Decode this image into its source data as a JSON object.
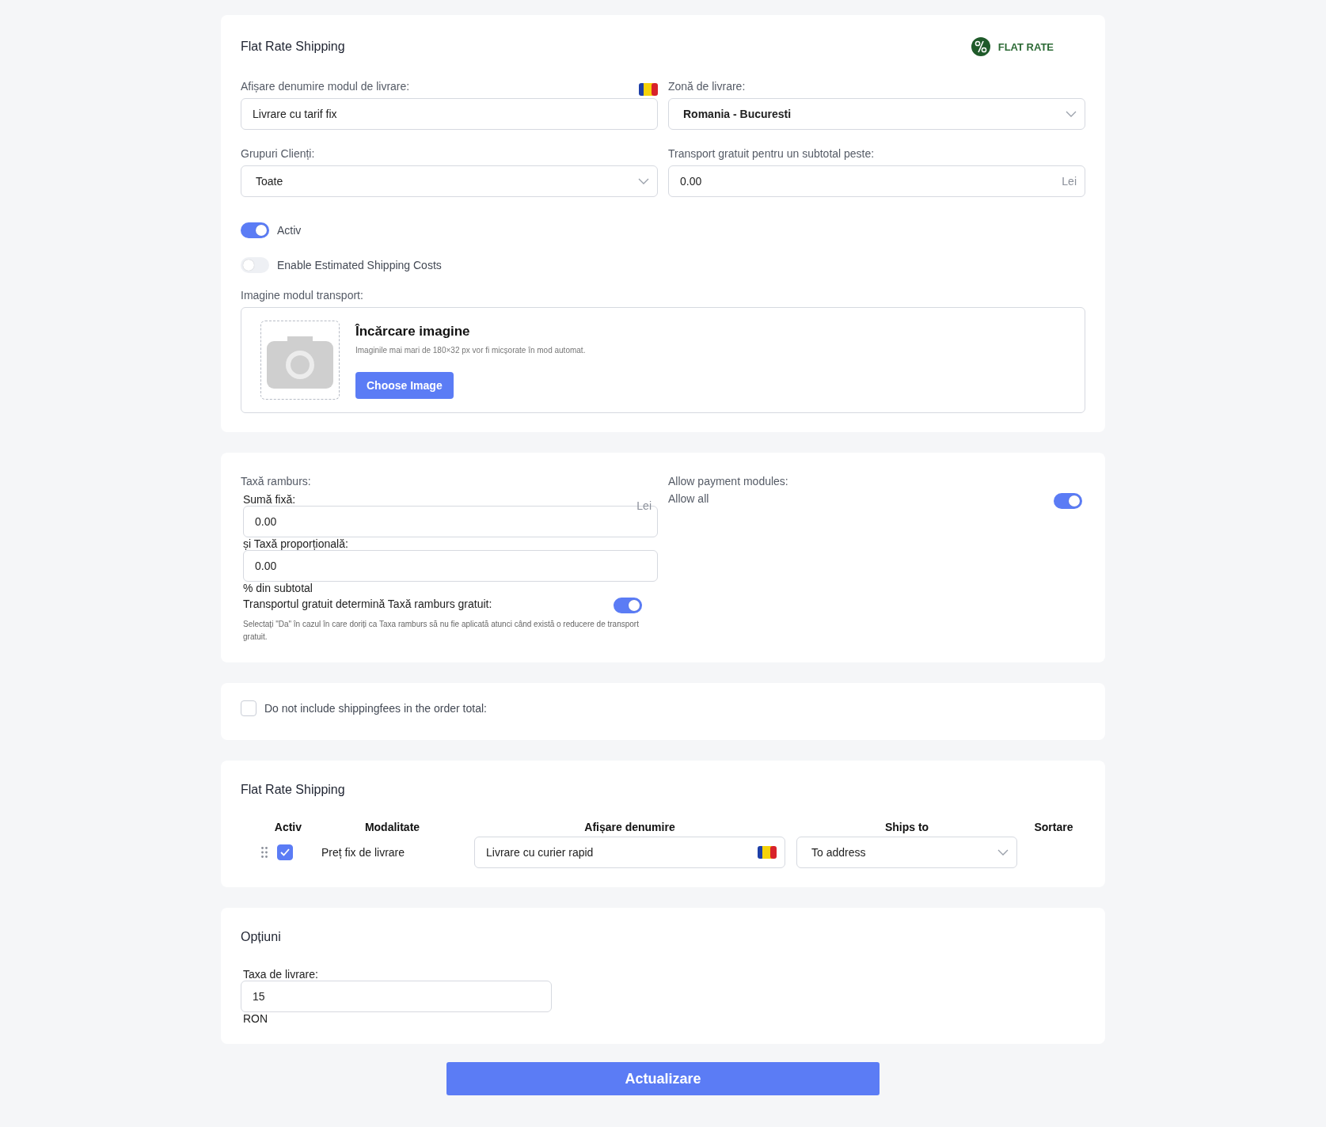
{
  "general": {
    "title": "Flat Rate Shipping",
    "badge": "FLAT RATE",
    "display_name": {
      "label": "Afișare denumire modul de livrare:",
      "value": "Livrare cu tarif fix"
    },
    "zone": {
      "label": "Zonă de livrare:",
      "value": "Romania - Bucuresti"
    },
    "groups": {
      "label": "Grupuri Clienți:",
      "value": "Toate"
    },
    "free_over": {
      "label": "Transport gratuit pentru un subtotal peste:",
      "value": "0.00",
      "unit": "Lei"
    },
    "toggles": [
      {
        "label": "Activ",
        "on": true
      },
      {
        "label": "Enable Estimated Shipping Costs",
        "on": false
      }
    ],
    "image": {
      "label": "Imagine modul transport:",
      "title": "Încărcare imagine",
      "hint": "Imaginile mai mari de 180×32 px vor fi micșorate în mod automat.",
      "button": "Choose Image"
    }
  },
  "cod": {
    "label": "Taxă ramburs:",
    "fixed": {
      "label": "Sumă fixă:",
      "value": "0.00",
      "unit": "Lei"
    },
    "proportional": {
      "label": "și Taxă proporțională:",
      "value": "0.00",
      "unit": "% din subtotal"
    },
    "free_cod": {
      "label": "Transportul gratuit determină Taxă ramburs gratuit:",
      "on": true
    },
    "note": "Selectați \"Da\" în cazul în care doriți ca Taxa ramburs să nu fie aplicată atunci când există o reducere de transport gratuit.",
    "payment": {
      "label": "Allow payment modules:",
      "value": "Allow all",
      "on": true
    }
  },
  "exclude": {
    "label": "Do not include shippingfees in the order total:",
    "checked": false
  },
  "methods": {
    "title": "Flat Rate Shipping",
    "columns": [
      "Activ",
      "Modalitate",
      "Afișare denumire",
      "Ships to",
      "Sortare"
    ],
    "rows": [
      {
        "active": true,
        "method": "Preț fix de livrare",
        "display": "Livrare cu curier rapid",
        "ships_to": "To address"
      }
    ]
  },
  "options": {
    "title": "Opțiuni",
    "fee": {
      "label": "Taxa de livrare:",
      "value": "15",
      "unit": "RON"
    }
  },
  "submit": "Actualizare"
}
